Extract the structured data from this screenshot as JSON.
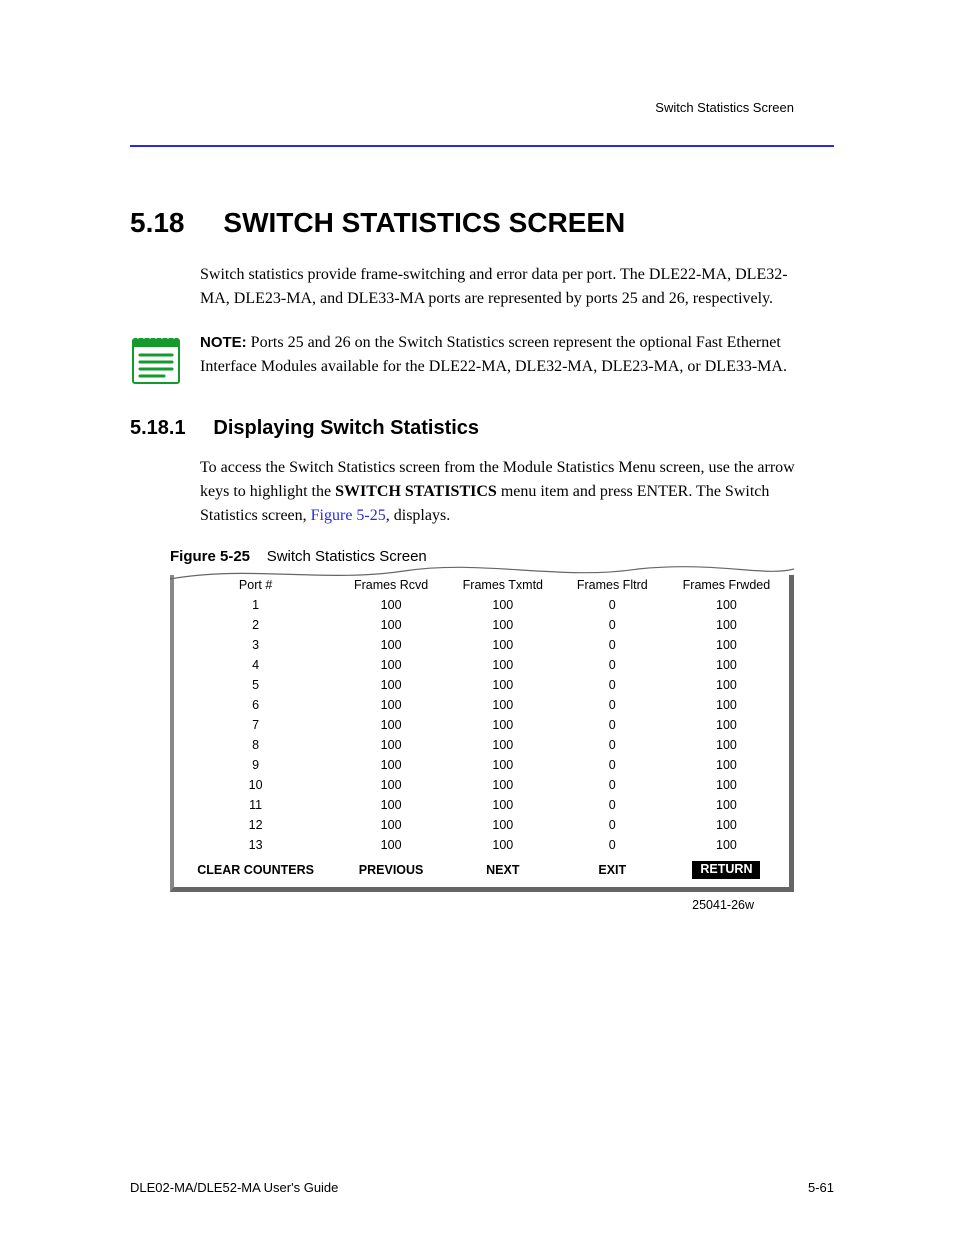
{
  "header": {
    "running_title": "Switch Statistics Screen"
  },
  "section": {
    "number": "5.18",
    "title": "SWITCH STATISTICS SCREEN"
  },
  "intro": "Switch statistics provide frame-switching and error data per port. The DLE22-MA, DLE32-MA, DLE23-MA, and DLE33-MA ports are represented by ports 25 and 26, respectively.",
  "note": {
    "label": "NOTE:",
    "text": "Ports 25 and 26 on the Switch Statistics screen represent the optional Fast Ethernet Interface Modules available for the DLE22-MA, DLE32-MA, DLE23-MA, or DLE33-MA."
  },
  "subsection": {
    "number": "5.18.1",
    "title": "Displaying Switch Statistics"
  },
  "body2": "To access the Switch Statistics screen from the Module Statistics Menu screen, use the arrow keys to highlight the SWITCH STATISTICS menu item and press ENTER. The Switch Statistics screen, , displays.",
  "body2_link": "Figure 5-25",
  "figure": {
    "caption_bold": "Figure 5-25",
    "caption_rest": "Switch Statistics Screen",
    "headers": [
      "Port #",
      "Frames Rcvd",
      "Frames Txmtd",
      "Frames Fltrd",
      "Frames Frwded"
    ],
    "rows": [
      {
        "port": "1",
        "rcvd": "100",
        "txmtd": "100",
        "fltrd": "0",
        "frwded": "100"
      },
      {
        "port": "2",
        "rcvd": "100",
        "txmtd": "100",
        "fltrd": "0",
        "frwded": "100"
      },
      {
        "port": "3",
        "rcvd": "100",
        "txmtd": "100",
        "fltrd": "0",
        "frwded": "100"
      },
      {
        "port": "4",
        "rcvd": "100",
        "txmtd": "100",
        "fltrd": "0",
        "frwded": "100"
      },
      {
        "port": "5",
        "rcvd": "100",
        "txmtd": "100",
        "fltrd": "0",
        "frwded": "100"
      },
      {
        "port": "6",
        "rcvd": "100",
        "txmtd": "100",
        "fltrd": "0",
        "frwded": "100"
      },
      {
        "port": "7",
        "rcvd": "100",
        "txmtd": "100",
        "fltrd": "0",
        "frwded": "100"
      },
      {
        "port": "8",
        "rcvd": "100",
        "txmtd": "100",
        "fltrd": "0",
        "frwded": "100"
      },
      {
        "port": "9",
        "rcvd": "100",
        "txmtd": "100",
        "fltrd": "0",
        "frwded": "100"
      },
      {
        "port": "10",
        "rcvd": "100",
        "txmtd": "100",
        "fltrd": "0",
        "frwded": "100"
      },
      {
        "port": "11",
        "rcvd": "100",
        "txmtd": "100",
        "fltrd": "0",
        "frwded": "100"
      },
      {
        "port": "12",
        "rcvd": "100",
        "txmtd": "100",
        "fltrd": "0",
        "frwded": "100"
      },
      {
        "port": "13",
        "rcvd": "100",
        "txmtd": "100",
        "fltrd": "0",
        "frwded": "100"
      }
    ],
    "buttons": {
      "clear": "CLEAR COUNTERS",
      "previous": "PREVIOUS",
      "next": "NEXT",
      "exit": "EXIT",
      "return": "RETURN"
    },
    "id": "25041-26w"
  },
  "footer": {
    "left": "DLE02-MA/DLE52-MA User's Guide",
    "right": "5-61"
  }
}
